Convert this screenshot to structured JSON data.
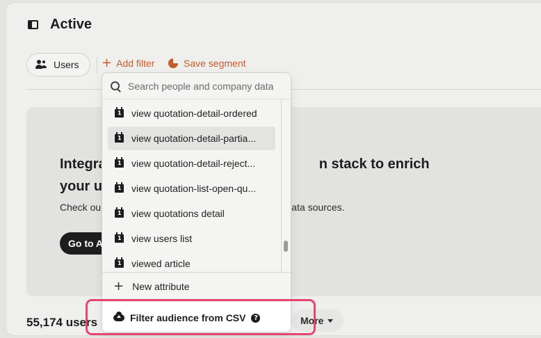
{
  "header": {
    "title": "Active"
  },
  "toolbar": {
    "users_chip": "Users",
    "add_filter": "Add filter",
    "save_segment": "Save segment"
  },
  "card": {
    "title": "Integrate your data stack to enrich your users",
    "title_visible_left_line1": "Integra",
    "title_visible_right_line1": "n stack to enrich",
    "title_visible_left_line2": "your u",
    "text_left": "Check ou",
    "text_right": "er data sources.",
    "button": "Go to A"
  },
  "footer": {
    "users_count": "55,174 users",
    "more": "More"
  },
  "dropdown": {
    "search_placeholder": "Search people and company data",
    "items": [
      {
        "label": "view quotation-detail-ordered"
      },
      {
        "label": "view quotation-detail-partia..."
      },
      {
        "label": "view quotation-detail-reject..."
      },
      {
        "label": "view quotation-list-open-qu..."
      },
      {
        "label": "view quotations detail"
      },
      {
        "label": "view users list"
      },
      {
        "label": "viewed article"
      }
    ],
    "new_attribute": "New attribute",
    "filter_csv": "Filter audience from CSV",
    "help_glyph": "?"
  },
  "colors": {
    "accent": "#c15b2a",
    "highlight": "#e4456e"
  }
}
